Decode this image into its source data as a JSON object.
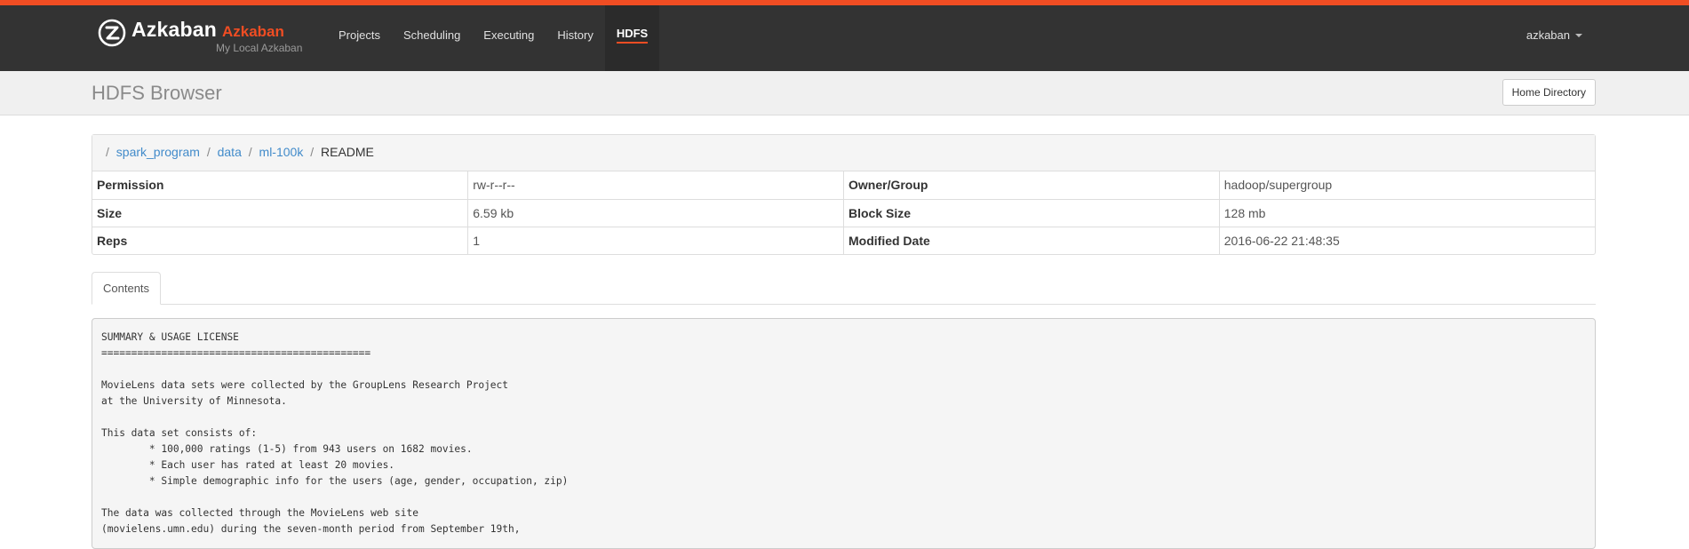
{
  "brand": {
    "name": "Azkaban",
    "subname": "Azkaban",
    "tagline": "My Local Azkaban",
    "accent_color": "#f04d23"
  },
  "nav": {
    "items": [
      {
        "label": "Projects"
      },
      {
        "label": "Scheduling"
      },
      {
        "label": "Executing"
      },
      {
        "label": "History"
      },
      {
        "label": "HDFS"
      }
    ],
    "active": "HDFS"
  },
  "user": {
    "name": "azkaban"
  },
  "page": {
    "title": "HDFS Browser",
    "home_button": "Home Directory"
  },
  "breadcrumb": {
    "separator": "/",
    "links": [
      "spark_program",
      "data",
      "ml-100k"
    ],
    "current": "README"
  },
  "meta": [
    {
      "l1": "Permission",
      "v1": "rw-r--r--",
      "l2": "Owner/Group",
      "v2": "hadoop/supergroup"
    },
    {
      "l1": "Size",
      "v1": "6.59 kb",
      "l2": "Block Size",
      "v2": "128 mb"
    },
    {
      "l1": "Reps",
      "v1": "1",
      "l2": "Modified Date",
      "v2": "2016-06-22 21:48:35"
    }
  ],
  "tabs": {
    "contents": "Contents"
  },
  "file_contents": "SUMMARY & USAGE LICENSE\n=============================================\n\nMovieLens data sets were collected by the GroupLens Research Project\nat the University of Minnesota.\n\nThis data set consists of:\n\t* 100,000 ratings (1-5) from 943 users on 1682 movies.\n\t* Each user has rated at least 20 movies.\n\t* Simple demographic info for the users (age, gender, occupation, zip)\n\nThe data was collected through the MovieLens web site\n(movielens.umn.edu) during the seven-month period from September 19th,"
}
